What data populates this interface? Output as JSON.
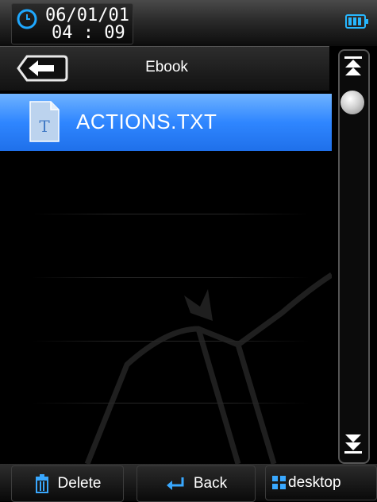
{
  "status": {
    "date": "06/01/01",
    "time": "04 : 09",
    "clock_icon": "clock-icon",
    "battery_icon": "battery-icon"
  },
  "header": {
    "title": "Ebook",
    "back_icon": "back-arrow-icon"
  },
  "list": {
    "items": [
      {
        "name": "ACTIONS.TXT",
        "icon": "text-file-icon",
        "selected": true
      }
    ]
  },
  "scrollbar": {
    "up_icon": "scroll-up-icon",
    "down_icon": "scroll-down-icon"
  },
  "bottom": {
    "delete_label": "Delete",
    "back_label": "Back",
    "desktop_label": "desktop"
  },
  "colors": {
    "accent": "#2f86ff",
    "clock": "#1fa8ff",
    "battery": "#27b7ff"
  }
}
